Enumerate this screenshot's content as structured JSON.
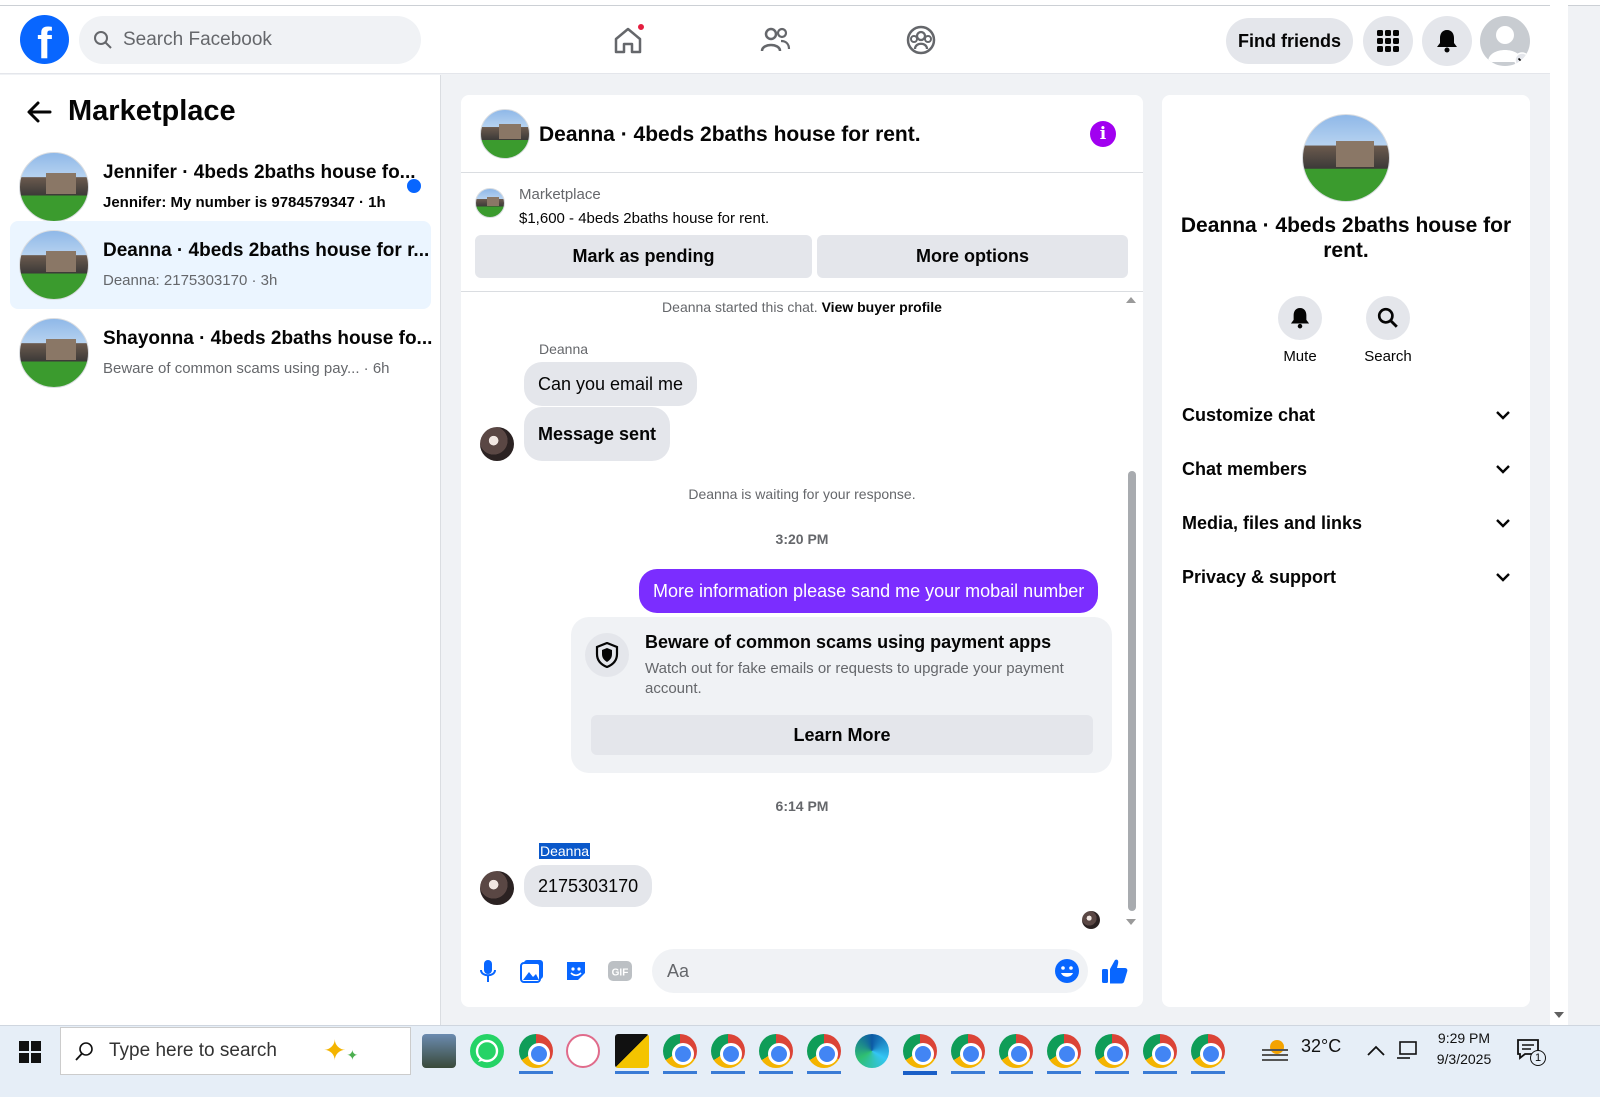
{
  "topnav": {
    "search_placeholder": "Search Facebook",
    "find_friends": "Find friends"
  },
  "sidebar": {
    "title": "Marketplace",
    "conversations": [
      {
        "name": "Jennifer · 4beds 2baths house fo...",
        "preview": "Jennifer: My number is 9784579347 · 1h",
        "unread": true
      },
      {
        "name": "Deanna · 4beds 2baths house for r...",
        "preview": "Deanna: 2175303170 · 3h",
        "unread": false
      },
      {
        "name": "Shayonna · 4beds 2baths house fo...",
        "preview": "Beware of common scams using pay...  · 6h",
        "unread": false
      }
    ]
  },
  "chat": {
    "title": "Deanna · 4beds 2baths house for rent.",
    "listing": {
      "label": "Marketplace",
      "price_title": "$1,600 - 4beds 2baths house for rent.",
      "mark_pending": "Mark as pending",
      "more_options": "More options"
    },
    "started_text": "Deanna started this chat.",
    "view_buyer": "View buyer profile",
    "sender_1": "Deanna",
    "msg_1": "Can you email me",
    "msg_2": "Message sent",
    "waiting": "Deanna is waiting for your response.",
    "time_1": "3:20 PM",
    "sent_msg": "More information please sand me your mobail number",
    "scam": {
      "title": "Beware of common scams using payment apps",
      "desc": "Watch out for fake emails or requests to upgrade your payment account.",
      "learn_more": "Learn More"
    },
    "time_2": "6:14 PM",
    "sender_2": "Deanna",
    "msg_3": "2175303170",
    "composer_placeholder": "Aa"
  },
  "details": {
    "title": "Deanna · 4beds 2baths house for rent.",
    "mute": "Mute",
    "search": "Search",
    "sections": [
      "Customize chat",
      "Chat members",
      "Media, files and links",
      "Privacy & support"
    ]
  },
  "taskbar": {
    "search_placeholder": "Type here to search",
    "temperature": "32°C",
    "time": "9:29 PM",
    "date": "9/3/2025",
    "notif_count": "1"
  },
  "colors": {
    "brand": "#0866ff",
    "sent_bubble": "#7b2dff",
    "info": "#a100f0"
  }
}
